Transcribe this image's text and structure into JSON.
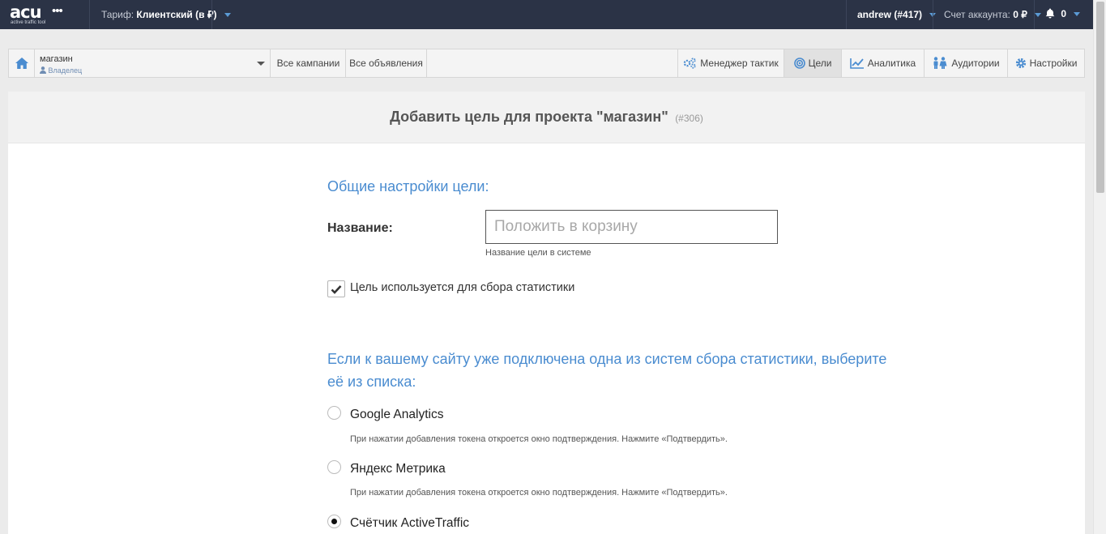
{
  "topbar": {
    "logo_mark": "acu",
    "logo_dots": "•••",
    "logo_sub": "active traffic tool",
    "tariff_label": "Тариф:",
    "tariff_value": "Клиентский (в ₽)",
    "user": "andrew (#417)",
    "account_label": "Счет аккаунта:",
    "account_value": "0 ₽",
    "notifications_count": "0"
  },
  "nav": {
    "project_name": "магазин",
    "project_role": "Владелец",
    "all_campaigns": "Все кампании",
    "all_ads": "Все объявления",
    "tactics_manager": "Менеджер тактик",
    "goals": "Цели",
    "analytics": "Аналитика",
    "audiences": "Аудитории",
    "settings": "Настройки"
  },
  "page": {
    "title": "Добавить цель для проекта \"магазин\"",
    "project_id": "(#306)",
    "general_section": "Общие настройки цели:",
    "name_label": "Название:",
    "name_placeholder": "Положить в корзину",
    "name_help": "Название цели в системе",
    "stats_checkbox_label": "Цель используется для сбора статистики",
    "stats_checkbox_checked": true,
    "systems_section": "Если к вашему сайту уже подключена одна из систем сбора статистики, выберите её из списка:",
    "systems": [
      {
        "label": "Google Analytics",
        "help": "При нажатии добавления токена откроется окно подтверждения. Нажмите «Подтвердить».",
        "checked": false
      },
      {
        "label": "Яндекс Метрика",
        "help": "При нажатии добавления токена откроется окно подтверждения. Нажмите «Подтвердить».",
        "checked": false
      },
      {
        "label": "Счётчик ActiveTraffic",
        "checked": true
      }
    ]
  },
  "colors": {
    "topbar_bg": "#2b3346",
    "accent": "#4a8cd0",
    "page_bg": "#ebebeb"
  },
  "icons": [
    "home-icon",
    "user-icon",
    "tactics-icon",
    "target-icon",
    "chart-icon",
    "people-icon",
    "gear-icon",
    "bell-icon",
    "check-icon"
  ]
}
